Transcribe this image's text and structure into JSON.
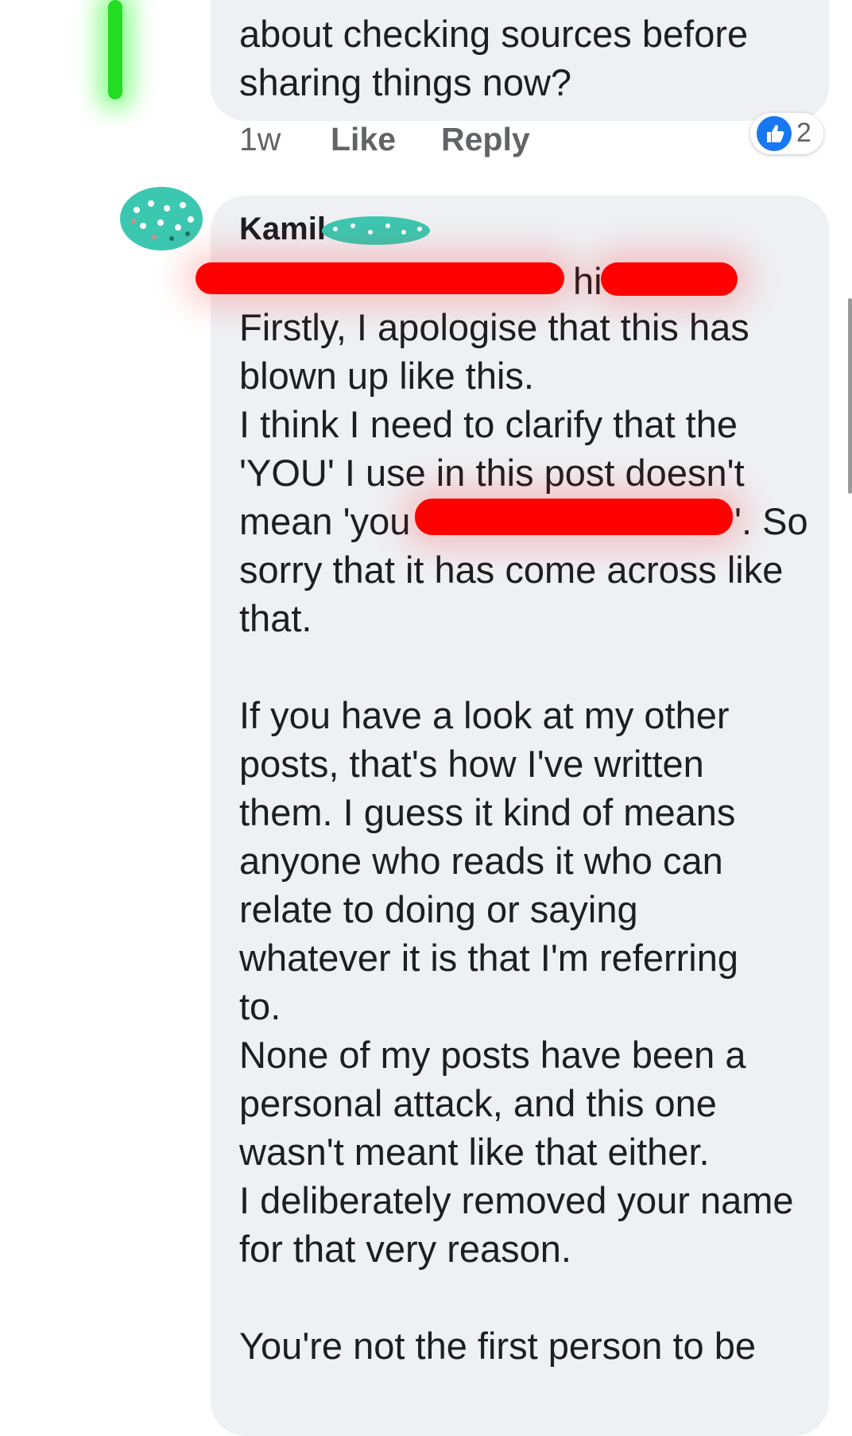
{
  "prev_comment": {
    "lines": [
      "about checking sources before",
      "sharing things now?"
    ],
    "time": "1w",
    "like_label": "Like",
    "reply_label": "Reply",
    "reaction_count": "2"
  },
  "comment": {
    "author": "Kamil",
    "partial_line_fragment": "hi",
    "lines": [
      "Firstly, I apologise that this has",
      "blown up like this.",
      "I think I need to clarify that the",
      "'YOU' I use in this post doesn't",
      "mean 'you",
      "'. So",
      "sorry that it has come across like",
      "that.",
      "If you have a look at my other",
      "posts, that's how I've written",
      "them. I guess it kind of means",
      "anyone who reads it who can",
      "relate to doing or saying",
      "whatever it is that I'm referring",
      "to.",
      "None of my posts have been a",
      "personal attack, and this one",
      "wasn't meant like that either.",
      "I deliberately removed your name",
      "for that very reason.",
      "You're not the first person to be"
    ]
  },
  "colors": {
    "bubble": "#eff0f3",
    "like_blue": "#1877f2",
    "redaction": "#ff0000",
    "thread_line": "#22dd22",
    "avatar_teal": "#3cc7b1"
  }
}
